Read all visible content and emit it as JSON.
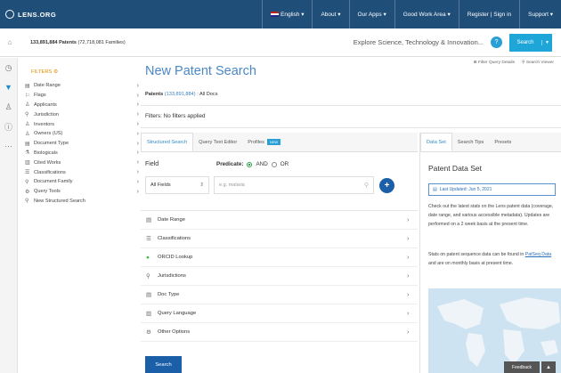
{
  "topbar": {
    "logo": "LENS.ORG",
    "nav": [
      {
        "label": "English",
        "flag": true
      },
      {
        "label": "About"
      },
      {
        "label": "Our Apps"
      },
      {
        "label": "Good Work Area"
      },
      {
        "label": "Register | Sign in"
      },
      {
        "label": "Support"
      }
    ]
  },
  "searchbar": {
    "patents_count": "133,891,884 Patents",
    "families": "(72,718,081 Families)",
    "explore_text": "Explore Science, Technology & Innovation...",
    "help": "?",
    "search_label": "Search"
  },
  "filters": {
    "heading": "FILTERS",
    "items": [
      {
        "icon": "calendar-icon",
        "glyph": "▤",
        "label": "Date Range",
        "chevron": true
      },
      {
        "icon": "flag-icon",
        "glyph": "⚐",
        "label": "Flags",
        "chevron": true
      },
      {
        "icon": "applicants-icon",
        "glyph": "♙",
        "label": "Applicants",
        "chevron": true
      },
      {
        "icon": "jurisdiction-icon",
        "glyph": "⚲",
        "label": "Jurisdiction",
        "chevron": true
      },
      {
        "icon": "inventors-icon",
        "glyph": "♙",
        "label": "Inventors",
        "chevron": true
      },
      {
        "icon": "owners-icon",
        "glyph": "♙",
        "label": "Owners (US)",
        "chevron": true
      },
      {
        "icon": "document-icon",
        "glyph": "▤",
        "label": "Document Type",
        "chevron": true
      },
      {
        "icon": "biologicals-icon",
        "glyph": "⚗",
        "label": "Biologicals",
        "chevron": true
      },
      {
        "icon": "cited-works-icon",
        "glyph": "▥",
        "label": "Cited Works",
        "chevron": true
      },
      {
        "icon": "classifications-icon",
        "glyph": "☰",
        "label": "Classifications",
        "chevron": true
      },
      {
        "icon": "family-icon",
        "glyph": "⚲",
        "label": "Document Family",
        "chevron": true
      },
      {
        "icon": "tools-icon",
        "glyph": "⚙",
        "label": "Query Tools",
        "chevron": true
      },
      {
        "icon": "search-icon",
        "glyph": "⚲",
        "label": "New Structured Search",
        "chevron": false
      }
    ]
  },
  "main": {
    "title": "New Patent Search",
    "option_links": [
      "Filter Query Details",
      "Search Viewer"
    ],
    "patents_label": "Patents",
    "patents_value": "(133,891,884)",
    "all_docs": ": All Docs",
    "filters_text": "Filters: No filters applied",
    "tabs": [
      {
        "label": "Structured Search",
        "active": true
      },
      {
        "label": "Query Text Editor",
        "active": false
      },
      {
        "label": "Profiles",
        "active": false,
        "badge": "NEW"
      }
    ],
    "field_label": "Field",
    "predicate_label": "Predicate:",
    "predicate_and": "AND",
    "predicate_or": "OR",
    "field_select": "All Fields",
    "query_placeholder": "e.g. malaria",
    "sections": [
      {
        "icon": "calendar-icon",
        "glyph": "▤",
        "label": "Date Range"
      },
      {
        "icon": "classifications-icon",
        "glyph": "☰",
        "label": "Classifications"
      },
      {
        "icon": "orcid-icon",
        "glyph": "●",
        "label": "ORCID Lookup",
        "green": true
      },
      {
        "icon": "jurisdiction-icon",
        "glyph": "⚲",
        "label": "Jurisdictions"
      },
      {
        "icon": "doc-type-icon",
        "glyph": "▤",
        "label": "Doc Type"
      },
      {
        "icon": "query-language-icon",
        "glyph": "▥",
        "label": "Query Language"
      },
      {
        "icon": "options-icon",
        "glyph": "⚙",
        "label": "Other Options"
      }
    ],
    "submit": "Search"
  },
  "rpanel": {
    "tabs": [
      {
        "label": "Data Set",
        "active": true
      },
      {
        "label": "Search Tips",
        "active": false
      },
      {
        "label": "Presets",
        "active": false
      }
    ],
    "title": "Patent Data Set",
    "updated": "Last Updated: Jun 5, 2021",
    "para1": "Check out the latest stats on the Lens patent data (coverage, date range, and various accessible metadata). Updates are performed on a 2 week basis at the present time.",
    "para2_pre": "Stats on patent sequence data can be found in",
    "para2_link": "PatSeq Data",
    "para2_post": "and are on monthly basis at present time.",
    "feedback": "Feedback"
  }
}
